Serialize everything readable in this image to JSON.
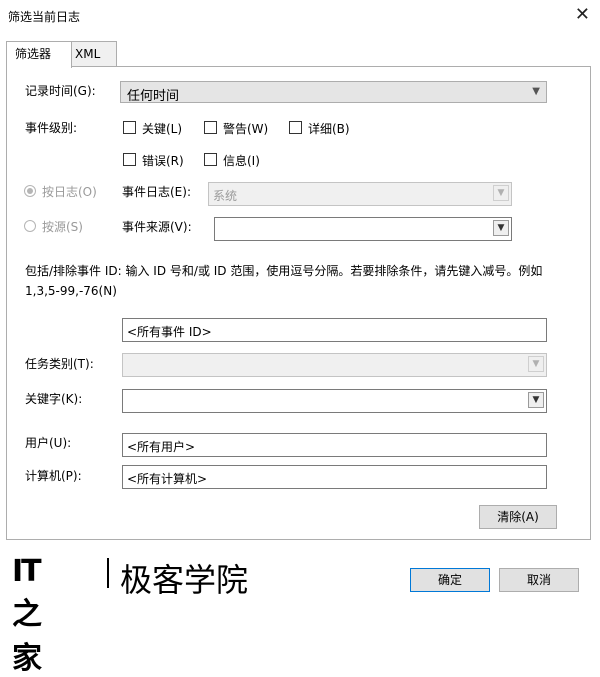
{
  "window": {
    "title": "筛选当前日志",
    "close_glyph": "✕"
  },
  "tabs": [
    {
      "label": "筛选器"
    },
    {
      "label": "XML"
    }
  ],
  "form": {
    "logged_label": "记录时间(G):",
    "logged_value": "任何时间",
    "level_label": "事件级别:",
    "levels": [
      "关键(L)",
      "警告(W)",
      "详细(B)",
      "错误(R)",
      "信息(I)"
    ],
    "by_log_label": "按日志(O)",
    "event_log_label": "事件日志(E):",
    "event_log_value": "系统",
    "by_source_label": "按源(S)",
    "event_source_label": "事件来源(V):",
    "event_source_value": "",
    "description": "包括/排除事件 ID: 输入 ID 号和/或 ID 范围，使用逗号分隔。若要排除条件，请先键入减号。例如 1,3,5-99,-76(N)",
    "event_id_value": "<所有事件 ID>",
    "task_category_label": "任务类别(T):",
    "task_category_value": "",
    "keywords_label": "关键字(K):",
    "keywords_value": "",
    "user_label": "用户(U):",
    "user_value": "<所有用户>",
    "computer_label": "计算机(P):",
    "computer_value": "<所有计算机>",
    "clear_label": "清除(A)"
  },
  "footer": {
    "ok_label": "确定",
    "cancel_label": "取消"
  },
  "logo": {
    "mark": "IT之家",
    "text": "极客学院"
  }
}
